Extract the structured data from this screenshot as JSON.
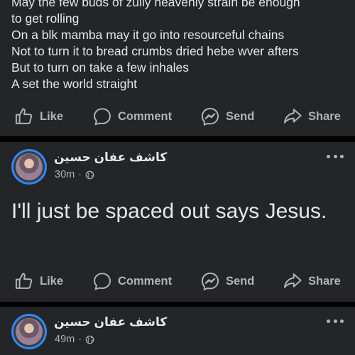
{
  "posts": [
    {
      "text": "May the few buds of zully heavenly strain be enough\nto get rolling\nOn a blk mamba may it go into resourceful chains\nNot to turn it to bread crumbs dried hebe wver afters\nBut to turn on take a few inhales\nA set the world straight"
    },
    {
      "author": "كاشف عفان حسين",
      "time": "30m",
      "separator": "·",
      "text": "I'll just be spaced out says Jesus.",
      "privacy_icon": "globe-icon"
    },
    {
      "author": "كاشف عفان حسين",
      "time": "49m",
      "separator": "·",
      "privacy_icon": "globe-icon"
    }
  ],
  "actions": {
    "like": "Like",
    "comment": "Comment",
    "send": "Send",
    "share": "Share"
  },
  "colors": {
    "background": "#000000",
    "card": "#242526",
    "primary_text": "#e4e6eb",
    "secondary_text": "#b0b3b8",
    "avatar_ring": "#2d88ff"
  }
}
